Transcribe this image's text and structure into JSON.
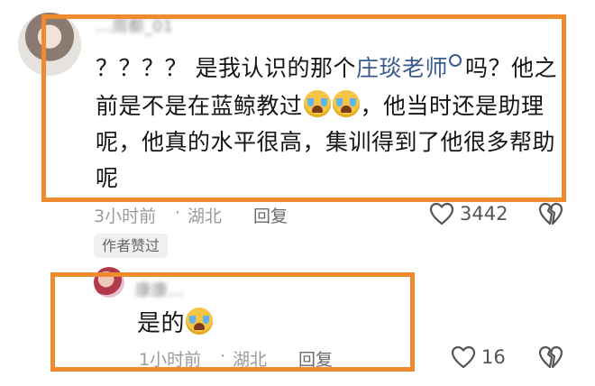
{
  "comment": {
    "username": "…周都_01",
    "text_before_mention": "？？？？ 是我认识的那个",
    "mention": "庄琰老师",
    "text_line1_tail": "吗？他之前是不是在蓝鲸教过",
    "text_after_emoji": "，他当时还是助理呢，他真的水平很高，集训得到了他很多帮助呢",
    "time": "3小时前",
    "location": "湖北",
    "reply_label": "回复",
    "likes": "3442",
    "author_liked_badge": "作者赞过",
    "emoji_count": 2,
    "emoji_name": "loudly-crying-face"
  },
  "reply": {
    "username": "康康…",
    "text": "是的",
    "time": "1小时前",
    "location": "湖北",
    "reply_label": "回复",
    "likes": "16",
    "emoji_name": "loudly-crying-face"
  },
  "separator": "·",
  "colors": {
    "highlight": "#f08a2e",
    "mention": "#3a5a8e",
    "meta": "#9a9a9a",
    "text": "#151515"
  }
}
